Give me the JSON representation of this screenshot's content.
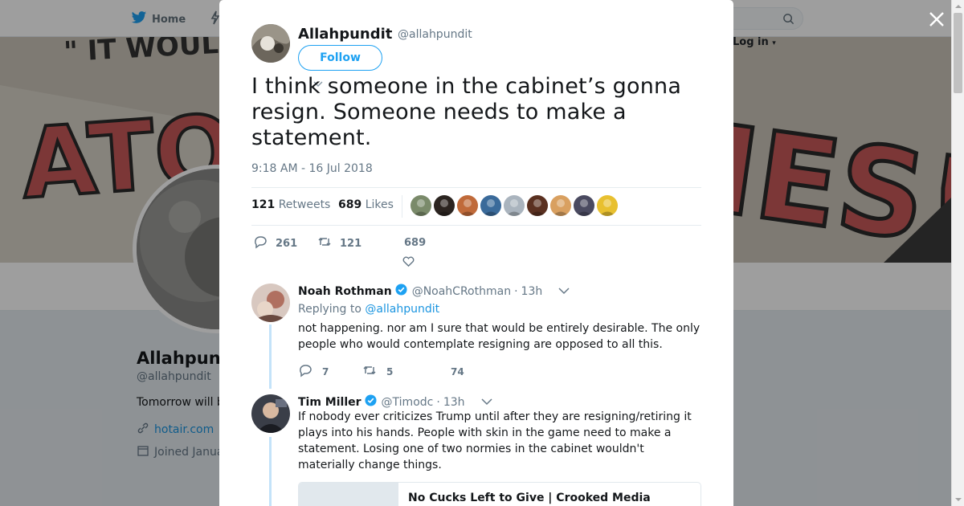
{
  "nav": {
    "home_label": "Home",
    "login_label": "Log in"
  },
  "background_profile": {
    "name": "Allahpundit",
    "handle": "@allahpundit",
    "bio": "Tomorrow will be",
    "website": "hotair.com",
    "joined": "Joined Janua"
  },
  "tweet": {
    "author_name": "Allahpundit",
    "author_handle": "@allahpundit",
    "follow_label": "Follow",
    "text": "I think someone in the cabinet’s gonna resign. Someone needs to make a statement.",
    "timestamp": "9:18 AM - 16 Jul 2018",
    "retweets_count": "121",
    "retweets_label": "Retweets",
    "likes_count": "689",
    "likes_label": "Likes",
    "actions": {
      "reply_count": "261",
      "retweet_count": "121",
      "like_count": "689"
    },
    "liker_colors": [
      "#7a8a6a",
      "#2b2420",
      "#c06a3a",
      "#3a6a9a",
      "#aab4be",
      "#5a3020",
      "#d9a060",
      "#4a4a60",
      "#e8c030"
    ]
  },
  "replies": [
    {
      "name": "Noah Rothman",
      "handle": "@NoahCRothman",
      "dot": "·",
      "time": "13h",
      "replying_prefix": "Replying to",
      "replying_to": "@allahpundit",
      "text": "not happening. nor am I sure that would be entirely desirable. The only people who would contemplate resigning are opposed to all this.",
      "reply_count": "7",
      "retweet_count": "5",
      "like_count": "74"
    },
    {
      "name": "Tim Miller",
      "handle": "@Timodc",
      "dot": "·",
      "time": "13h",
      "text": "If nobody ever criticizes Trump until after they are resigning/retiring it plays into his hands. People with skin in the game need to make a statement. Losing one of two normies in the cabinet wouldn't materially change things.",
      "card_title": "No Cucks Left to Give | Crooked Media"
    }
  ],
  "colors": {
    "accent": "#1da1f2",
    "link": "#1b95e0",
    "muted": "#657786"
  }
}
